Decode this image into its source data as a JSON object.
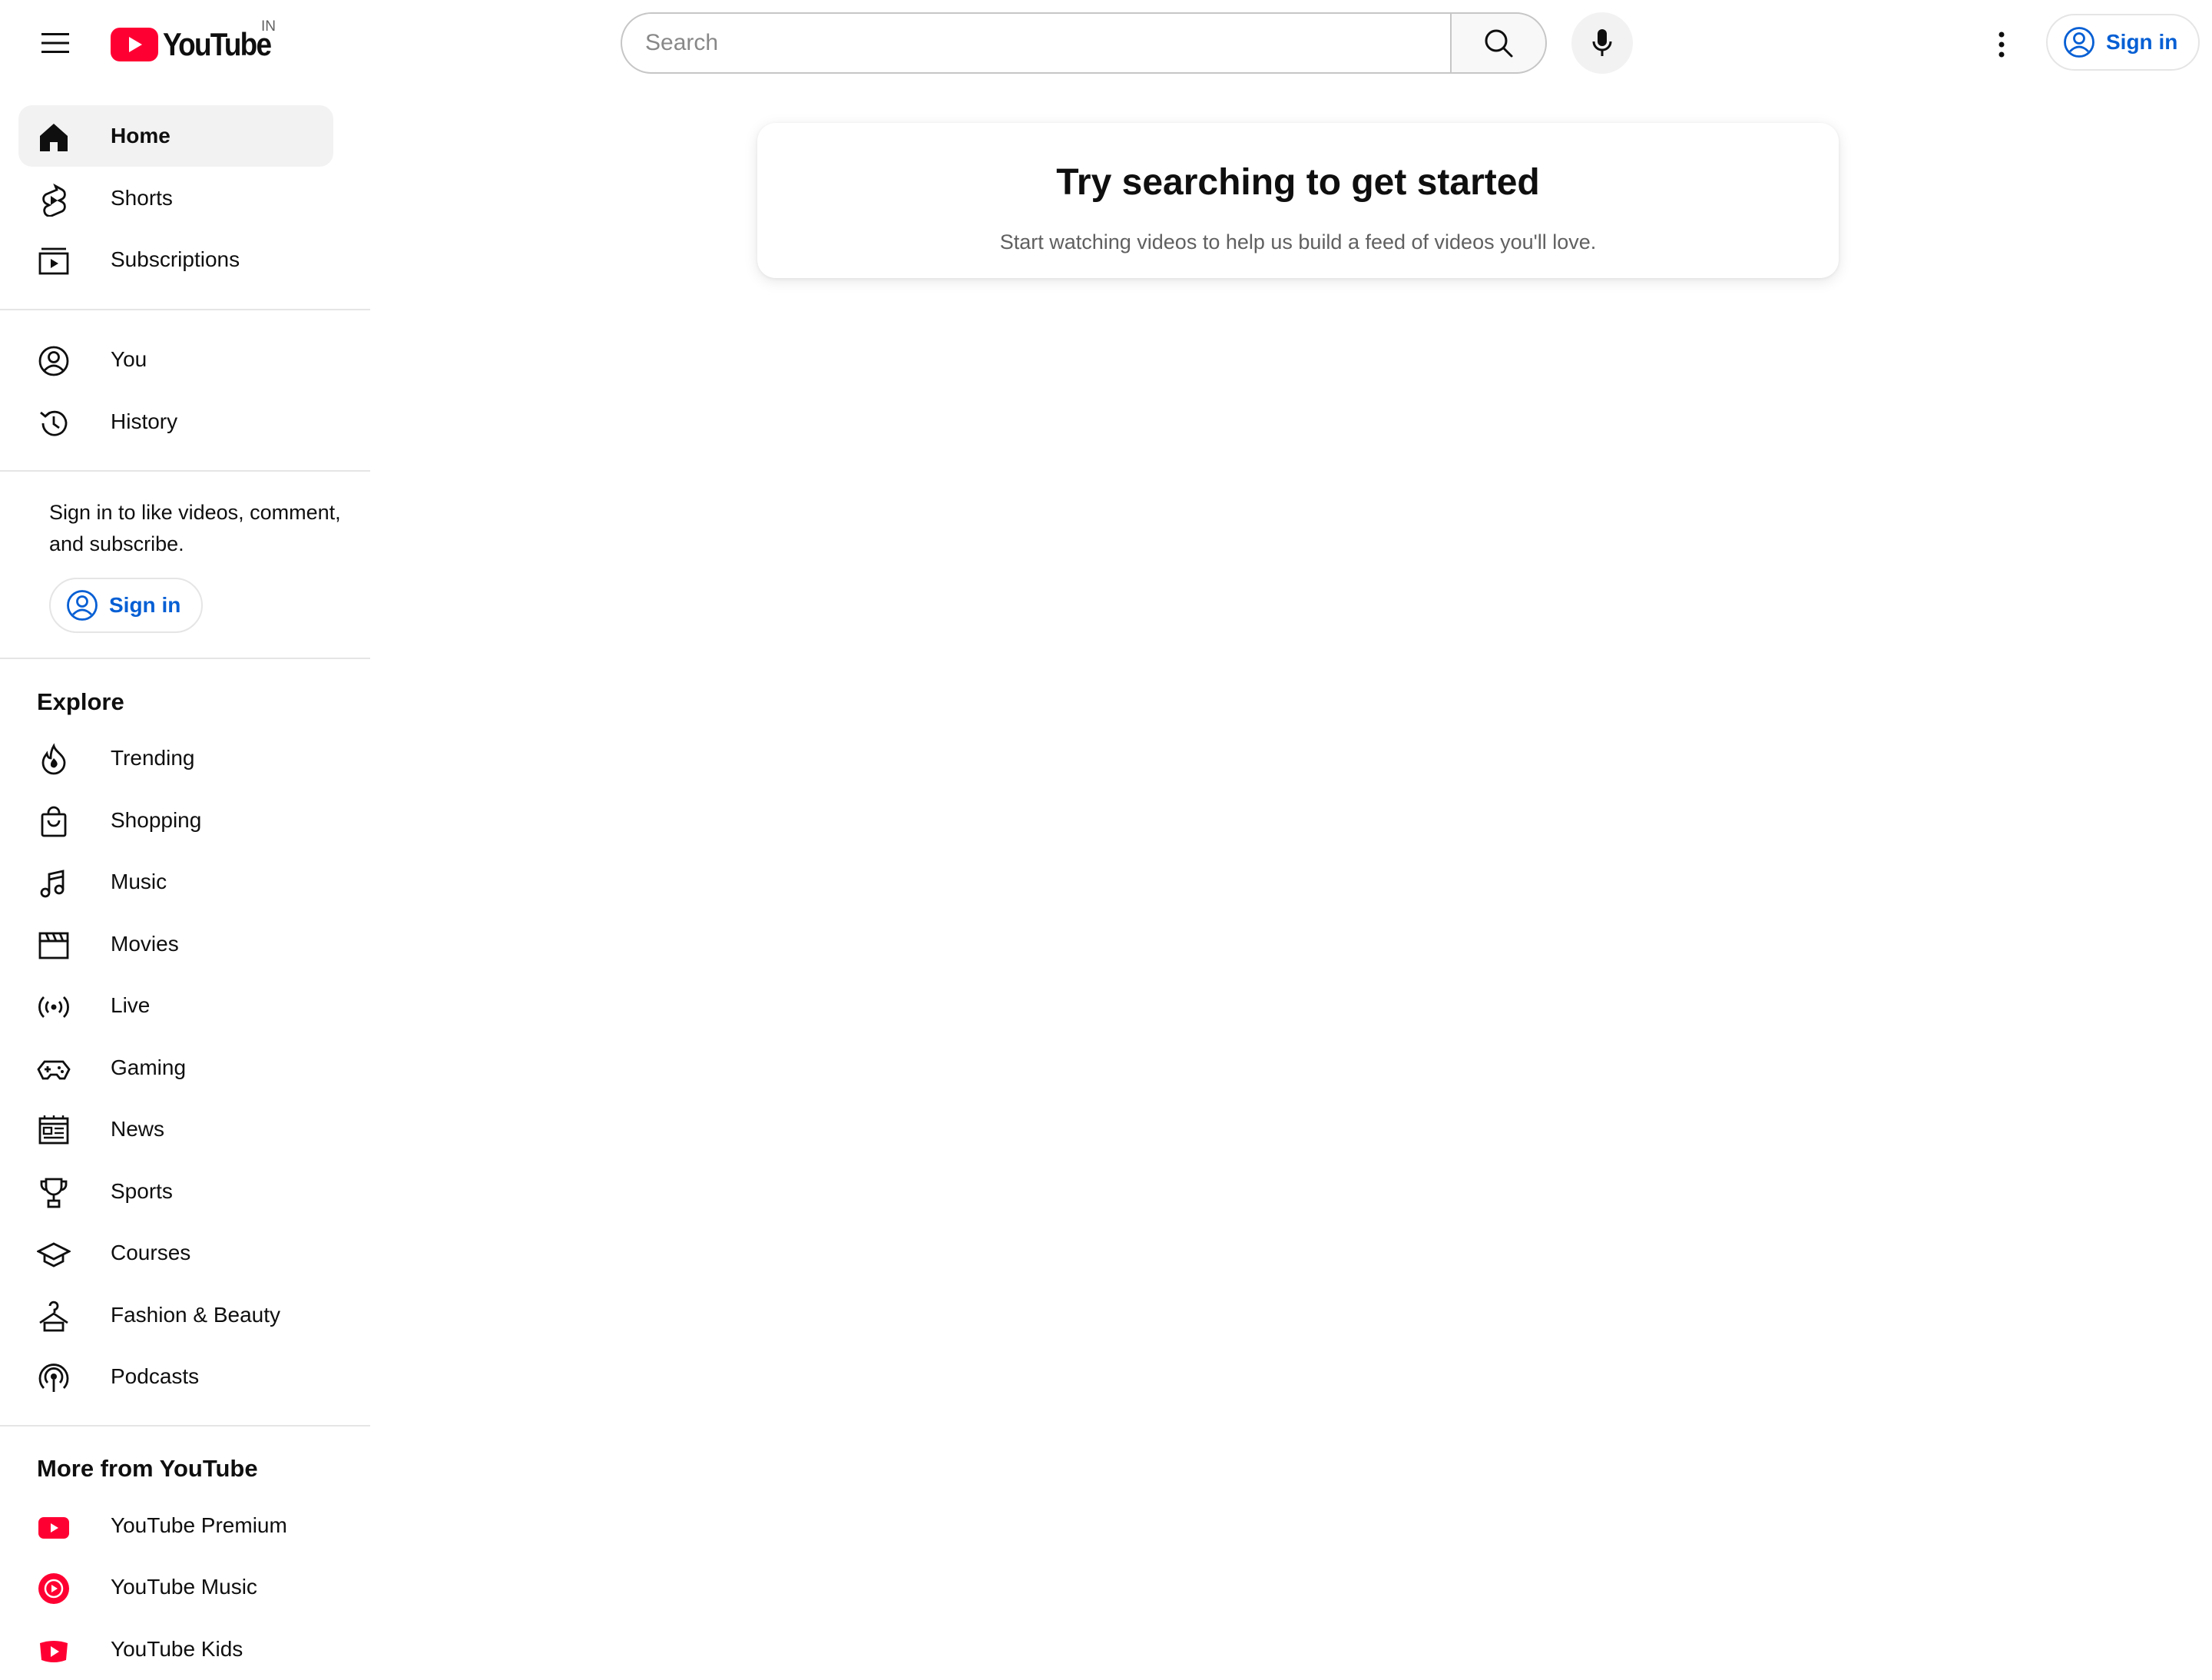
{
  "masthead": {
    "logo_text": "YouTube",
    "country_code": "IN",
    "search_placeholder": "Search",
    "sign_in_label": "Sign in"
  },
  "sidebar": {
    "primary": [
      {
        "label": "Home",
        "icon": "home-icon",
        "active": true
      },
      {
        "label": "Shorts",
        "icon": "shorts-icon"
      },
      {
        "label": "Subscriptions",
        "icon": "subscriptions-icon"
      }
    ],
    "you": [
      {
        "label": "You",
        "icon": "account-icon"
      },
      {
        "label": "History",
        "icon": "history-icon"
      }
    ],
    "sign_in_prompt": "Sign in to like videos, comment, and subscribe.",
    "sign_in_label": "Sign in",
    "explore_title": "Explore",
    "explore": [
      {
        "label": "Trending",
        "icon": "trending-icon"
      },
      {
        "label": "Shopping",
        "icon": "shopping-bag-icon"
      },
      {
        "label": "Music",
        "icon": "music-note-icon"
      },
      {
        "label": "Movies",
        "icon": "clapperboard-icon"
      },
      {
        "label": "Live",
        "icon": "live-broadcast-icon"
      },
      {
        "label": "Gaming",
        "icon": "gamepad-icon"
      },
      {
        "label": "News",
        "icon": "newspaper-icon"
      },
      {
        "label": "Sports",
        "icon": "trophy-icon"
      },
      {
        "label": "Courses",
        "icon": "graduation-cap-icon"
      },
      {
        "label": "Fashion & Beauty",
        "icon": "hanger-icon"
      },
      {
        "label": "Podcasts",
        "icon": "podcast-icon"
      }
    ],
    "more_title": "More from YouTube",
    "more": [
      {
        "label": "YouTube Premium",
        "icon": "youtube-premium-icon"
      },
      {
        "label": "YouTube Music",
        "icon": "youtube-music-icon"
      },
      {
        "label": "YouTube Kids",
        "icon": "youtube-kids-icon"
      }
    ]
  },
  "main": {
    "card_title": "Try searching to get started",
    "card_subtitle": "Start watching videos to help us build a feed of videos you'll love."
  },
  "colors": {
    "brand_red": "#ff0033",
    "link_blue": "#065fd4",
    "active_bg": "#f2f2f2"
  }
}
